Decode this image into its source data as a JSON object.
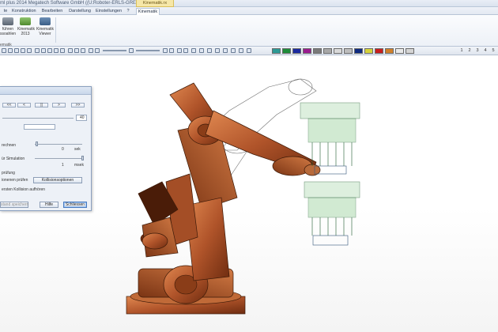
{
  "window": {
    "title": "ml plus 2014 Megatech Software GmbH ((U:Roboter-ERLS-GREIFER.PRT))",
    "context_tab": "Kinematik.rx"
  },
  "ribbon_tabs": [
    {
      "label": "te"
    },
    {
      "label": "Konstruktion"
    },
    {
      "label": "Bearbeiten"
    },
    {
      "label": "Darstellung"
    },
    {
      "label": "Einstellungen"
    },
    {
      "label": "?"
    },
    {
      "label": "Kinematik"
    }
  ],
  "ribbon": {
    "buttons": [
      {
        "label1": "führen",
        "label2": "ssoahlen"
      },
      {
        "label1": "Kinematik",
        "label2": "2013"
      },
      {
        "label1": "Kinematik",
        "label2": "Viewer"
      }
    ],
    "group_label": "ematik"
  },
  "toolbar": {
    "colors": [
      "#2c9a95",
      "#1f8c3a",
      "#1c2aa0",
      "#9a1c8f",
      "#7a7a7a",
      "#a8a8a8",
      "#d9d9d9",
      "#bdbdbd",
      "#0f2a80",
      "#d6d23a",
      "#c81e1e",
      "#d0802a",
      "#e9e9e9",
      "#d5d5d5"
    ],
    "numbers": [
      "1",
      "2",
      "3",
      "4",
      "5"
    ]
  },
  "dialog": {
    "nav_buttons": [
      "<<",
      "<",
      "||",
      ">",
      ">>"
    ],
    "field_value": "40",
    "row1_label": "rechnen",
    "row1_value": "0",
    "row1_unit": "sek",
    "row2_label": "ür Simulation",
    "row2_value": "1",
    "row2_unit": "msek",
    "section_label": "prüfung",
    "check1_label": "ionenen prüfen",
    "collision_button": "Kollisionsoptionen",
    "check2_label": "ersten Kollision aufhören",
    "save_button": "stand speichern",
    "help_button": "Hilfe",
    "close_button": "Schliessen"
  }
}
